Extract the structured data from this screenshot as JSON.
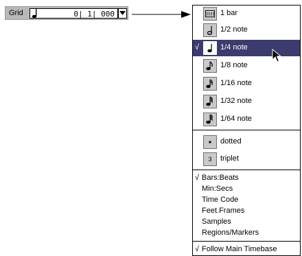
{
  "grid": {
    "label": "Grid",
    "value": "0| 1| 000",
    "note_icon": "quarter-note-icon",
    "dropdown_icon": "triangle-down-icon"
  },
  "menu": {
    "note_items": [
      {
        "label": "1 bar",
        "icon": "bar-icon",
        "checked": false,
        "selected": false
      },
      {
        "label": "1/2 note",
        "icon": "half-note-icon",
        "checked": false,
        "selected": false
      },
      {
        "label": "1/4 note",
        "icon": "quarter-note-icon",
        "checked": true,
        "selected": true
      },
      {
        "label": "1/8 note",
        "icon": "eighth-note-icon",
        "checked": false,
        "selected": false
      },
      {
        "label": "1/16 note",
        "icon": "sixteenth-note-icon",
        "checked": false,
        "selected": false
      },
      {
        "label": "1/32 note",
        "icon": "thirty-second-note-icon",
        "checked": false,
        "selected": false
      },
      {
        "label": "1/64 note",
        "icon": "sixty-fourth-note-icon",
        "checked": false,
        "selected": false
      }
    ],
    "modifier_items": [
      {
        "label": "dotted",
        "icon": "dot-icon",
        "checked": false
      },
      {
        "label": "triplet",
        "icon": "triplet-icon",
        "checked": false,
        "icon_text": "3"
      }
    ],
    "timebase_items": [
      {
        "label": "Bars:Beats",
        "checked": true
      },
      {
        "label": "Min:Secs",
        "checked": false
      },
      {
        "label": "Time Code",
        "checked": false
      },
      {
        "label": "Feet.Frames",
        "checked": false
      },
      {
        "label": "Samples",
        "checked": false
      },
      {
        "label": "Regions/Markers",
        "checked": false
      }
    ],
    "follow_item": {
      "label": "Follow Main Timebase",
      "checked": true
    },
    "check_mark": "√",
    "colors": {
      "selected_bg": "#3b3b6e",
      "icon_box_bg": "#c9c9c9"
    }
  }
}
